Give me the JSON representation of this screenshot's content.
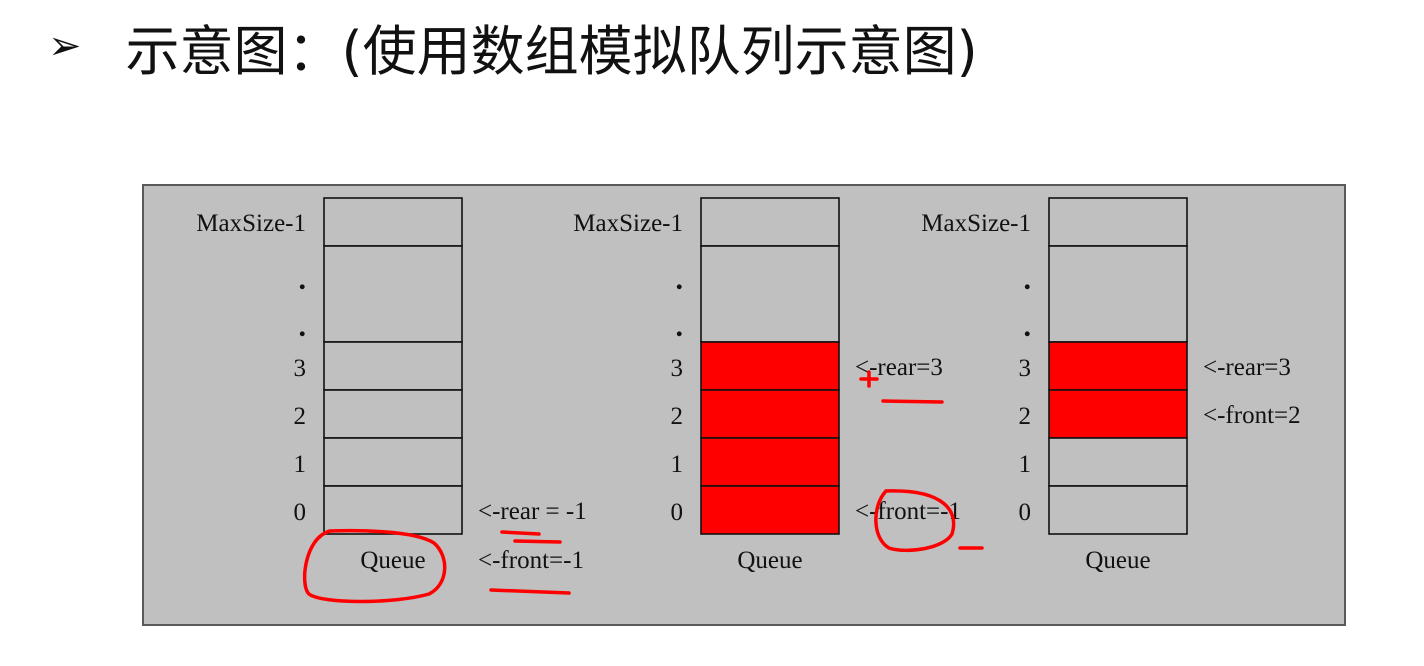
{
  "title": {
    "bullet": "➢",
    "text": "示意图：(使用数组模拟队列示意图)"
  },
  "colors": {
    "background": "#c0c0c0",
    "filled_cell": "#ff0000",
    "empty_cell": "#c0c0c0",
    "annotation": "#ff0000"
  },
  "queues": [
    {
      "row_labels": [
        "MaxSize-1",
        ".",
        ".",
        "3",
        "2",
        "1",
        "0"
      ],
      "filled_indices": [],
      "caption": "Queue",
      "pointers": [
        {
          "text": "<-rear = -1",
          "index": 0
        },
        {
          "text": "<-front=-1",
          "index": -1
        }
      ]
    },
    {
      "row_labels": [
        "MaxSize-1",
        ".",
        ".",
        "3",
        "2",
        "1",
        "0"
      ],
      "filled_indices": [
        0,
        1,
        2,
        3
      ],
      "caption": "Queue",
      "pointers": [
        {
          "text": "<-rear=3",
          "index": 3
        },
        {
          "text": "<-front=-1",
          "index": 0
        }
      ]
    },
    {
      "row_labels": [
        "MaxSize-1",
        ".",
        ".",
        "3",
        "2",
        "1",
        "0"
      ],
      "filled_indices": [
        2,
        3
      ],
      "caption": "Queue",
      "pointers": [
        {
          "text": "<-rear=3",
          "index": 3
        },
        {
          "text": "<-front=2",
          "index": 2
        }
      ]
    }
  ]
}
